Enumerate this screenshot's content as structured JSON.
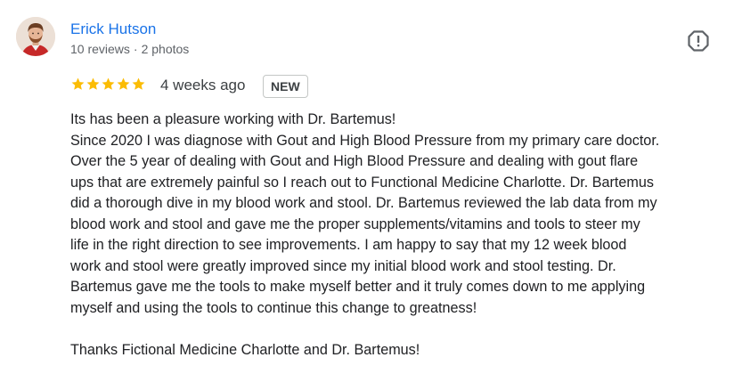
{
  "reviewer": {
    "name": "Erick Hutson",
    "reviews_count": "10 reviews",
    "separator": "·",
    "photos_count": "2 photos"
  },
  "review": {
    "rating": 5,
    "rating_max": 5,
    "date": "4 weeks ago",
    "badge": "NEW",
    "lines": [
      "Its has been a pleasure working with Dr. Bartemus!",
      "Since 2020 I was diagnose with Gout and High Blood Pressure from my primary care doctor.",
      "Over the 5 year of dealing with Gout and High Blood Pressure and dealing with gout flare",
      "ups that are extremely painful so I reach out to Functional Medicine Charlotte. Dr. Bartemus",
      "did a thorough dive in my blood work and stool. Dr. Bartemus reviewed the lab data from my",
      "blood work and stool and gave me the proper supplements/vitamins and tools to steer my",
      "life in the right direction to see improvements. I am happy to say that my 12 week blood",
      "work and stool were greatly improved since my initial blood work and stool testing. Dr.",
      "Bartemus gave me the tools to make myself better and it truly comes down to me applying",
      "myself and using the tools to continue this change to greatness!",
      "",
      "Thanks Fictional Medicine Charlotte and Dr. Bartemus!"
    ]
  },
  "icons": {
    "star": "star-icon",
    "report": "report-icon"
  },
  "colors": {
    "name_link": "#1a73e8",
    "star": "#fbbc04",
    "meta_text": "#5f6368",
    "body_text": "#202124"
  }
}
